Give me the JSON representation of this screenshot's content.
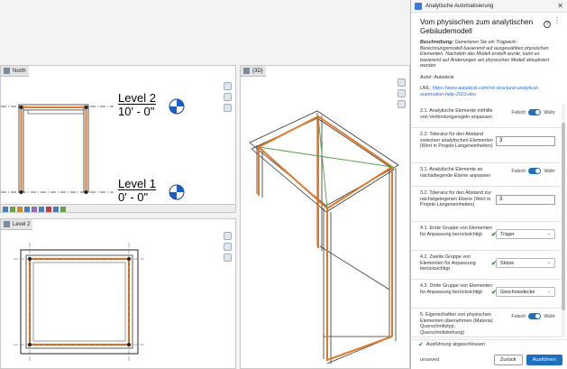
{
  "views": {
    "elevation_tab": "North",
    "plan_tab": "Level 2",
    "view3d_tab": "{3D}",
    "levels": [
      {
        "name": "Level 2",
        "value": "10' - 0\""
      },
      {
        "name": "Level 1",
        "value": "0' - 0\""
      }
    ]
  },
  "panel": {
    "window_title": "Analytische Automatisierung",
    "close_symbol": "✕",
    "heading": "Vom physischen zum analytischen Gebäudemodell",
    "help_symbol": "?",
    "more_symbol": "⋮",
    "description_label": "Beschreibung:",
    "description_text": "Generieren Sie ein Tragwerk-Berechnungsmodell basierend auf ausgewählten physischen Elementen. Nachdem das Modell erstellt wurde, kann es basierend auf Änderungen am physischen Modell aktualisiert werden.",
    "author": "Autor: Autodesk",
    "url_label": "URL:",
    "url": "https://www.autodesk.com/rvt-structural-analytical-automation-help-2023-deu",
    "settings": [
      {
        "type": "toggle",
        "label": "2.1. Analytische Elemente mithilfe von Verbindungsregeln anpassen",
        "off": "Falsch",
        "on": "Wahr"
      },
      {
        "type": "number",
        "label": "2.2. Toleranz für den Abstand zwischen analytischen Elementen (Wert in Projekt-Längeneinheiten)",
        "value": "3"
      },
      {
        "type": "toggle",
        "label": "3.1. Analytische Elemente an nächstliegende Ebene anpassen",
        "off": "Falsch",
        "on": "Wahr"
      },
      {
        "type": "number",
        "label": "3.2. Toleranz für den Abstand zur nächstgelegenen Ebene (Wert in Projekt-Längeneinheiten)",
        "value": "3"
      },
      {
        "type": "select",
        "label": "4.1. Erste Gruppe von Elementen für Anpassung berücksichtigt",
        "value": "Träger"
      },
      {
        "type": "select",
        "label": "4.2. Zweite Gruppe von Elementen für Anpassung berücksichtigt",
        "value": "Stütze"
      },
      {
        "type": "select",
        "label": "4.3. Dritte Gruppe von Elementen für Anpassung berücksichtigt",
        "value": "Geschossdecke"
      },
      {
        "type": "toggle",
        "label": "5. Eigenschaften von physischen Elementen übernehmen (Material, Querschnittstyp, Querschnittdrehung)",
        "off": "Falsch",
        "on": "Wahr"
      }
    ],
    "check_symbol": "✔",
    "chevron_symbol": "⌄",
    "status_symbol": "✔",
    "status": "Ausführung abgeschlossen",
    "unsaved": "unsaved",
    "reset_label": "Zurück",
    "run_label": "Ausführen"
  }
}
